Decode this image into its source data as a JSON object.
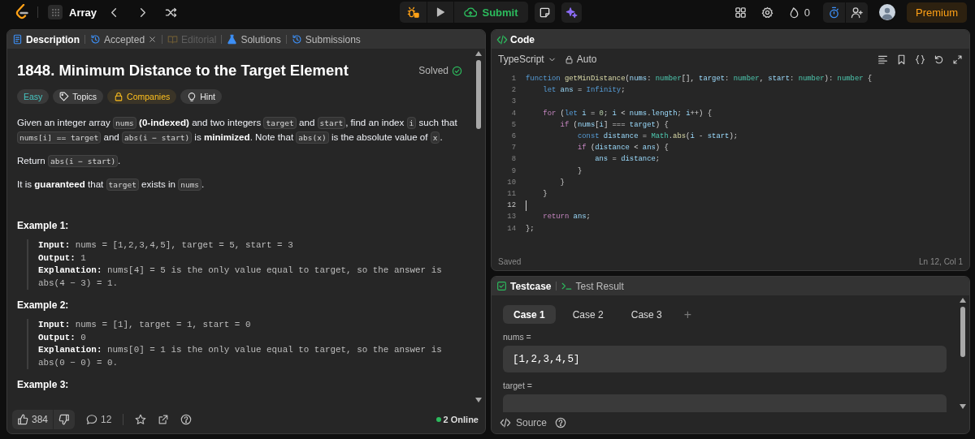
{
  "top_bar": {
    "list_name": "Array",
    "submit": "Submit",
    "streak": "0",
    "premium": "Premium"
  },
  "problem_tabs": [
    {
      "label": "Description",
      "selected": true,
      "closable": false,
      "disabled": false
    },
    {
      "label": "Accepted",
      "selected": false,
      "closable": true,
      "disabled": false
    },
    {
      "label": "Editorial",
      "selected": false,
      "closable": false,
      "disabled": true
    },
    {
      "label": "Solutions",
      "selected": false,
      "closable": false,
      "disabled": false
    },
    {
      "label": "Submissions",
      "selected": false,
      "closable": false,
      "disabled": false
    }
  ],
  "problem": {
    "title": "1848. Minimum Distance to the Target Element",
    "status": "Solved",
    "tags": [
      {
        "kind": "difficulty",
        "label": "Easy"
      },
      {
        "kind": "topics",
        "label": "Topics"
      },
      {
        "kind": "companies",
        "label": "Companies"
      },
      {
        "kind": "hint",
        "label": "Hint"
      }
    ],
    "paragraphs": [
      [
        {
          "kind": "text",
          "text": "Given an integer array "
        },
        {
          "kind": "code",
          "text": "nums"
        },
        {
          "kind": "text",
          "text": " **(0-indexed)** and two integers "
        },
        {
          "kind": "code",
          "text": "target"
        },
        {
          "kind": "text",
          "text": " and "
        },
        {
          "kind": "code",
          "text": "start"
        },
        {
          "kind": "text",
          "text": ", find an index "
        },
        {
          "kind": "code",
          "text": "i"
        },
        {
          "kind": "text",
          "text": " such that "
        },
        {
          "kind": "code",
          "text": "nums[i] == target"
        },
        {
          "kind": "text",
          "text": " and "
        },
        {
          "kind": "code",
          "text": "abs(i − start)"
        },
        {
          "kind": "text",
          "text": " is **minimized**. Note that "
        },
        {
          "kind": "code",
          "text": "abs(x)"
        },
        {
          "kind": "text",
          "text": " is the absolute value of "
        },
        {
          "kind": "code",
          "text": "x"
        },
        {
          "kind": "text",
          "text": "."
        }
      ],
      [
        {
          "kind": "text",
          "text": "Return "
        },
        {
          "kind": "code",
          "text": "abs(i − start)"
        },
        {
          "kind": "text",
          "text": "."
        }
      ],
      [
        {
          "kind": "text",
          "text": "It is **guaranteed** that "
        },
        {
          "kind": "code",
          "text": "target"
        },
        {
          "kind": "text",
          "text": " exists in "
        },
        {
          "kind": "code",
          "text": "nums"
        },
        {
          "kind": "text",
          "text": "."
        }
      ]
    ],
    "examples": [
      {
        "title": "Example 1:",
        "lines": [
          {
            "label": "Input:",
            "text": "nums = [1,2,3,4,5], target = 5, start = 3"
          },
          {
            "label": "Output:",
            "text": "1"
          },
          {
            "label": "Explanation:",
            "text": "nums[4] = 5 is the only value equal to target, so the answer is abs(4 − 3) = 1."
          }
        ]
      },
      {
        "title": "Example 2:",
        "lines": [
          {
            "label": "Input:",
            "text": "nums = [1], target = 1, start = 0"
          },
          {
            "label": "Output:",
            "text": "0"
          },
          {
            "label": "Explanation:",
            "text": "nums[0] = 1 is the only value equal to target, so the answer is abs(0 − 0) = 0."
          }
        ]
      },
      {
        "title": "Example 3:"
      }
    ],
    "likes": "384",
    "comments": "12",
    "online": "2 Online"
  },
  "code_panel": {
    "title": "Code",
    "language": "TypeScript",
    "mode": "Auto",
    "saved": "Saved",
    "cursor": "Ln 12, Col 1",
    "lines": [
      {
        "number": "1",
        "current": false,
        "tokens": [
          {
            "kind": "kw",
            "text": "function"
          },
          {
            "kind": "fn",
            "text": " getMinDistance"
          },
          {
            "kind": "p",
            "text": "("
          },
          {
            "kind": "var",
            "text": "nums"
          },
          {
            "kind": "p",
            "text": ": "
          },
          {
            "kind": "type",
            "text": "number"
          },
          {
            "kind": "p",
            "text": "[], "
          },
          {
            "kind": "var",
            "text": "target"
          },
          {
            "kind": "p",
            "text": ": "
          },
          {
            "kind": "type",
            "text": "number"
          },
          {
            "kind": "p",
            "text": ", "
          },
          {
            "kind": "var",
            "text": "start"
          },
          {
            "kind": "p",
            "text": ": "
          },
          {
            "kind": "type",
            "text": "number"
          },
          {
            "kind": "p",
            "text": "): "
          },
          {
            "kind": "type",
            "text": "number"
          },
          {
            "kind": "p",
            "text": " {"
          }
        ]
      },
      {
        "number": "2",
        "current": false,
        "tokens": [
          {
            "kind": "kw",
            "text": "    let"
          },
          {
            "kind": "var",
            "text": " ans"
          },
          {
            "kind": "p",
            "text": " = "
          },
          {
            "kind": "kw",
            "text": "Infinity"
          },
          {
            "kind": "p",
            "text": ";"
          }
        ]
      },
      {
        "number": "3",
        "current": false
      },
      {
        "number": "4",
        "current": false,
        "tokens": [
          {
            "kind": "ctl",
            "text": "    for"
          },
          {
            "kind": "p",
            "text": " ("
          },
          {
            "kind": "kw",
            "text": "let"
          },
          {
            "kind": "var",
            "text": " i"
          },
          {
            "kind": "p",
            "text": " = "
          },
          {
            "kind": "num",
            "text": "0"
          },
          {
            "kind": "p",
            "text": "; "
          },
          {
            "kind": "var",
            "text": "i"
          },
          {
            "kind": "p",
            "text": " < "
          },
          {
            "kind": "var",
            "text": "nums"
          },
          {
            "kind": "p",
            "text": "."
          },
          {
            "kind": "var",
            "text": "length"
          },
          {
            "kind": "p",
            "text": "; "
          },
          {
            "kind": "var",
            "text": "i"
          },
          {
            "kind": "p",
            "text": "++) {"
          }
        ]
      },
      {
        "number": "5",
        "current": false,
        "tokens": [
          {
            "kind": "ctl",
            "text": "        if"
          },
          {
            "kind": "p",
            "text": " ("
          },
          {
            "kind": "var",
            "text": "nums"
          },
          {
            "kind": "p",
            "text": "["
          },
          {
            "kind": "var",
            "text": "i"
          },
          {
            "kind": "p",
            "text": "] === "
          },
          {
            "kind": "var",
            "text": "target"
          },
          {
            "kind": "p",
            "text": ") {"
          }
        ]
      },
      {
        "number": "6",
        "current": false,
        "tokens": [
          {
            "kind": "kw",
            "text": "            const"
          },
          {
            "kind": "var",
            "text": " distance"
          },
          {
            "kind": "p",
            "text": " = "
          },
          {
            "kind": "type",
            "text": "Math"
          },
          {
            "kind": "p",
            "text": "."
          },
          {
            "kind": "fn",
            "text": "abs"
          },
          {
            "kind": "p",
            "text": "("
          },
          {
            "kind": "var",
            "text": "i"
          },
          {
            "kind": "p",
            "text": " - "
          },
          {
            "kind": "var",
            "text": "start"
          },
          {
            "kind": "p",
            "text": ");"
          }
        ]
      },
      {
        "number": "7",
        "current": false,
        "tokens": [
          {
            "kind": "ctl",
            "text": "            if"
          },
          {
            "kind": "p",
            "text": " ("
          },
          {
            "kind": "var",
            "text": "distance"
          },
          {
            "kind": "p",
            "text": " < "
          },
          {
            "kind": "var",
            "text": "ans"
          },
          {
            "kind": "p",
            "text": ") {"
          }
        ]
      },
      {
        "number": "8",
        "current": false,
        "tokens": [
          {
            "kind": "var",
            "text": "                ans"
          },
          {
            "kind": "p",
            "text": " = "
          },
          {
            "kind": "var",
            "text": "distance"
          },
          {
            "kind": "p",
            "text": ";"
          }
        ]
      },
      {
        "number": "9",
        "current": false,
        "tokens": [
          {
            "kind": "p",
            "text": "            }"
          }
        ]
      },
      {
        "number": "10",
        "current": false,
        "tokens": [
          {
            "kind": "p",
            "text": "        }"
          }
        ]
      },
      {
        "number": "11",
        "current": false,
        "tokens": [
          {
            "kind": "p",
            "text": "    }"
          }
        ]
      },
      {
        "number": "12",
        "current": true
      },
      {
        "number": "13",
        "current": false,
        "tokens": [
          {
            "kind": "ctl",
            "text": "    return"
          },
          {
            "kind": "var",
            "text": " ans"
          },
          {
            "kind": "p",
            "text": ";"
          }
        ]
      },
      {
        "number": "14",
        "current": false,
        "tokens": [
          {
            "kind": "p",
            "text": "};"
          }
        ]
      }
    ]
  },
  "test_panel": {
    "tabs": [
      {
        "label": "Testcase",
        "selected": true
      },
      {
        "label": "Test Result",
        "selected": false
      }
    ],
    "cases": [
      {
        "label": "Case 1",
        "selected": true
      },
      {
        "label": "Case 2",
        "selected": false
      },
      {
        "label": "Case 3",
        "selected": false
      }
    ],
    "add_case": "+",
    "fields": [
      {
        "label": "nums =",
        "value": "[1,2,3,4,5]"
      },
      {
        "label": "target ="
      }
    ],
    "source": "Source"
  }
}
